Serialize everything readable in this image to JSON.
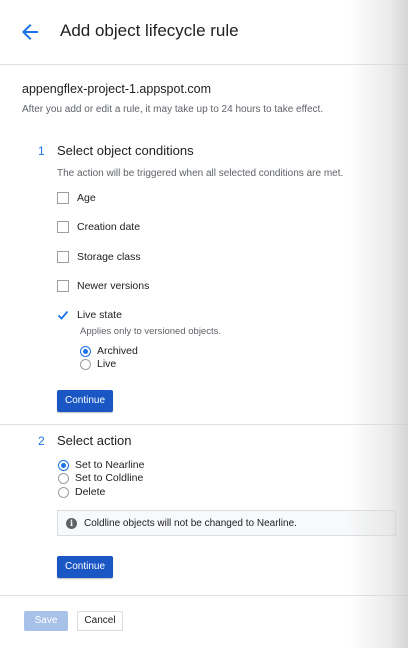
{
  "header": {
    "title": "Add object lifecycle rule",
    "back_icon": "arrow-back-icon"
  },
  "bucket": {
    "name": "appengflex-project-1.appspot.com",
    "note": "After you add or edit a rule, it may take up to 24 hours to take effect."
  },
  "step1": {
    "number": "1",
    "title": "Select object conditions",
    "description": "The action will be triggered when all selected conditions are met.",
    "conditions": [
      {
        "label": "Age",
        "checked": false
      },
      {
        "label": "Creation date",
        "checked": false
      },
      {
        "label": "Storage class",
        "checked": false
      },
      {
        "label": "Newer versions",
        "checked": false
      },
      {
        "label": "Live state",
        "checked": true
      }
    ],
    "live_state_note": "Applies only to versioned objects.",
    "live_state_options": [
      {
        "label": "Archived",
        "selected": true
      },
      {
        "label": "Live",
        "selected": false
      }
    ],
    "continue_label": "Continue"
  },
  "step2": {
    "number": "2",
    "title": "Select action",
    "actions": [
      {
        "label": "Set to Nearline",
        "selected": true
      },
      {
        "label": "Set to Coldline",
        "selected": false
      },
      {
        "label": "Delete",
        "selected": false
      }
    ],
    "info_text": "Coldline objects will not be changed to Nearline.",
    "continue_label": "Continue"
  },
  "footer": {
    "save_label": "Save",
    "cancel_label": "Cancel"
  },
  "colors": {
    "accent": "#1a73e8",
    "primary_button": "#1a56c4",
    "disabled_button": "#a8c1e8"
  }
}
